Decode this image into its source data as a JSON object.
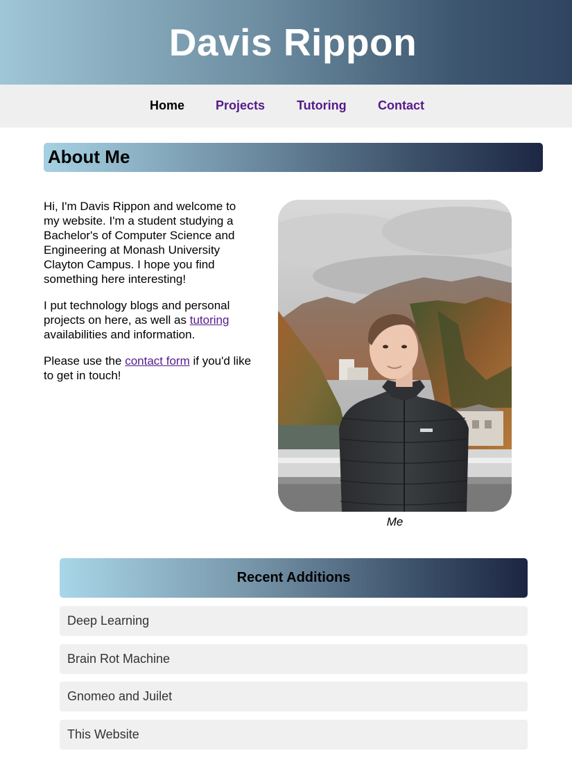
{
  "header": {
    "title": "Davis Rippon"
  },
  "nav": {
    "items": [
      {
        "label": "Home"
      },
      {
        "label": "Projects"
      },
      {
        "label": "Tutoring"
      },
      {
        "label": "Contact"
      }
    ]
  },
  "about": {
    "heading": "About Me",
    "p1": "Hi, I'm Davis Rippon and welcome to my website. I'm a student studying a Bachelor's of Computer Science and Engineering at Monash University Clayton Campus. I hope you find something here interesting!",
    "p2_before": "I put technology blogs and personal projects on here, as well as ",
    "p2_link": "tutoring",
    "p2_after": " availabilities and information.",
    "p3_before": "Please use the ",
    "p3_link": "contact form",
    "p3_after": " if you'd like to get in touch!",
    "photo_caption": "Me"
  },
  "recent": {
    "heading": "Recent Additions",
    "items": [
      {
        "label": "Deep Learning"
      },
      {
        "label": "Brain Rot Machine"
      },
      {
        "label": "Gnomeo and Juilet"
      },
      {
        "label": "This Website"
      }
    ]
  },
  "colors": {
    "link": "#551a8b",
    "nav_bg": "#efefef",
    "card_bg": "#f0f0f0"
  }
}
